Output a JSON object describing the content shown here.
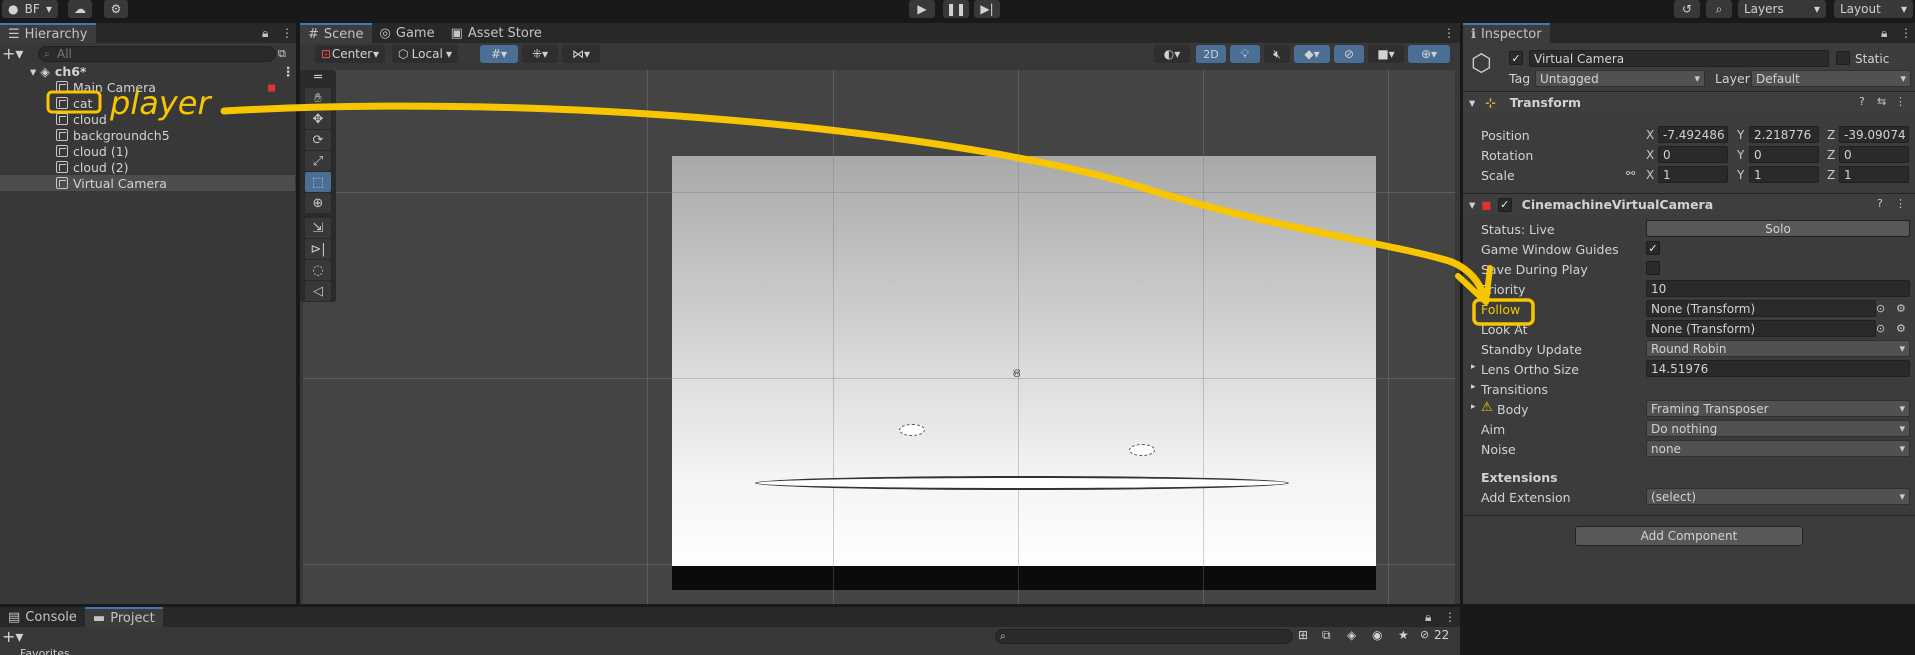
{
  "topbar": {
    "account": "BF",
    "layers": "Layers",
    "layout": "Layout"
  },
  "hierarchy": {
    "title": "Hierarchy",
    "search_placeholder": "All",
    "scene_name": "ch6*",
    "items": [
      "Main Camera",
      "cat",
      "cloud",
      "backgroundch5",
      "cloud (1)",
      "cloud (2)",
      "Virtual Camera"
    ]
  },
  "scene_tabs": [
    "Scene",
    "Game",
    "Asset Store"
  ],
  "scene_toolbar": {
    "pivot": "Center",
    "space": "Local",
    "mode_2d": "2D"
  },
  "annotation": {
    "label": "player",
    "color": "#f7c600"
  },
  "inspector": {
    "title": "Inspector",
    "object_name": "Virtual Camera",
    "static_label": "Static",
    "tag_label": "Tag",
    "tag_value": "Untagged",
    "layer_label": "Layer",
    "layer_value": "Default",
    "transform": {
      "title": "Transform",
      "position": {
        "label": "Position",
        "x": "-7.492486",
        "y": "2.218776",
        "z": "-39.09074"
      },
      "rotation": {
        "label": "Rotation",
        "x": "0",
        "y": "0",
        "z": "0"
      },
      "scale": {
        "label": "Scale",
        "x": "1",
        "y": "1",
        "z": "1"
      }
    },
    "cinemachine": {
      "title": "CinemachineVirtualCamera",
      "status_label": "Status: Live",
      "solo": "Solo",
      "game_window_guides": "Game Window Guides",
      "save_during_play": "Save During Play",
      "priority_label": "Priority",
      "priority_value": "10",
      "follow_label": "Follow",
      "follow_value": "None (Transform)",
      "look_at_label": "Look At",
      "look_at_value": "None (Transform)",
      "standby_label": "Standby Update",
      "standby_value": "Round Robin",
      "lens_label": "Lens Ortho Size",
      "lens_value": "14.51976",
      "transitions": "Transitions",
      "body_label": "Body",
      "body_value": "Framing Transposer",
      "aim_label": "Aim",
      "aim_value": "Do nothing",
      "noise_label": "Noise",
      "noise_value": "none",
      "extensions": "Extensions",
      "add_extension_label": "Add Extension",
      "add_extension_value": "(select)"
    },
    "add_component": "Add Component"
  },
  "bottom": {
    "tabs": [
      "Console",
      "Project"
    ],
    "favorites": "Favorites",
    "hidden_count": "22"
  },
  "colors": {
    "accent": "#3a79bb",
    "annotation": "#f7c600",
    "bg": "#383838"
  }
}
